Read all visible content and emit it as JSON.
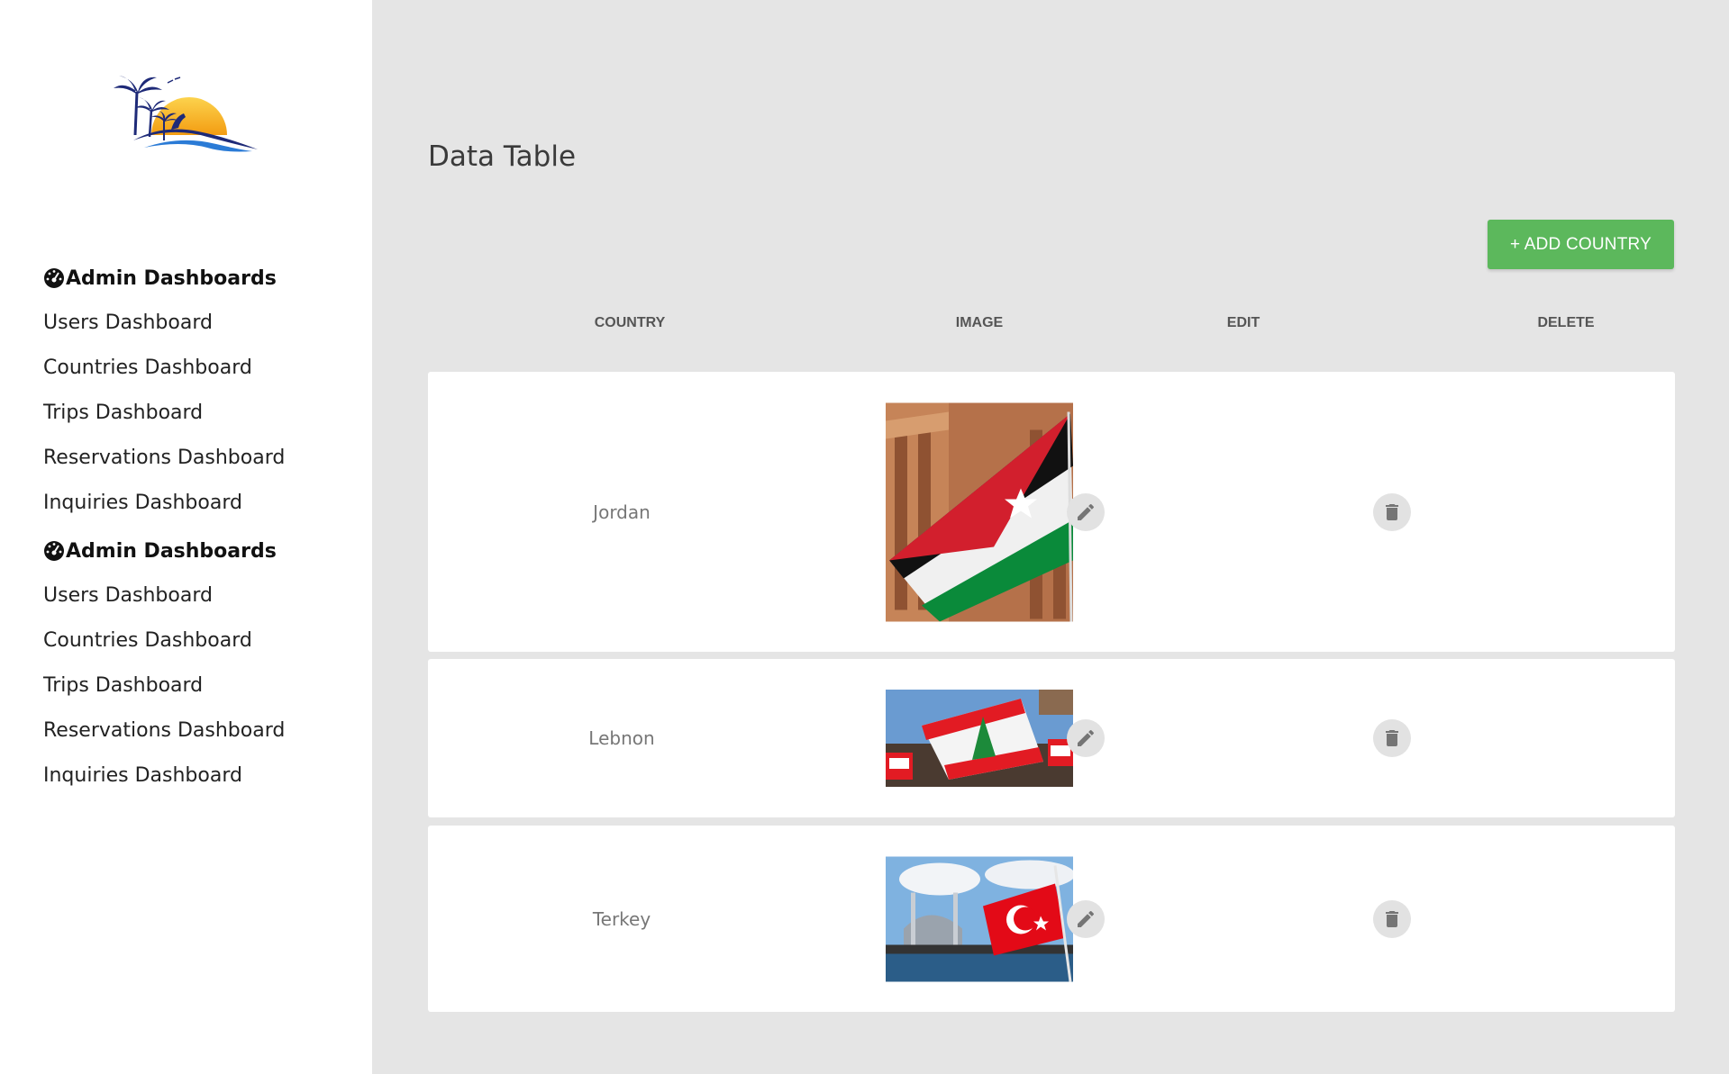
{
  "sidebar": {
    "groups": [
      {
        "heading": "Admin Dashboards",
        "items": [
          "Users Dashboard",
          "Countries Dashboard",
          "Trips Dashboard",
          "Reservations Dashboard",
          "Inquiries Dashboard"
        ]
      },
      {
        "heading": "Admin Dashboards",
        "items": [
          "Users Dashboard",
          "Countries Dashboard",
          "Trips Dashboard",
          "Reservations Dashboard",
          "Inquiries Dashboard"
        ]
      }
    ]
  },
  "main": {
    "title": "Data Table",
    "add_button": "+ ADD COUNTRY",
    "columns": [
      "COUNTRY",
      "IMAGE",
      "EDIT",
      "DELETE"
    ],
    "rows": [
      {
        "country": "Jordan",
        "image": "jordan-flag-photo"
      },
      {
        "country": "Lebnon",
        "image": "lebanon-flag-photo"
      },
      {
        "country": "Terkey",
        "image": "turkey-flag-photo"
      }
    ]
  },
  "colors": {
    "accent_green": "#5cb85c",
    "sidebar_bg": "#ffffff",
    "main_bg": "#e5e5e5"
  }
}
